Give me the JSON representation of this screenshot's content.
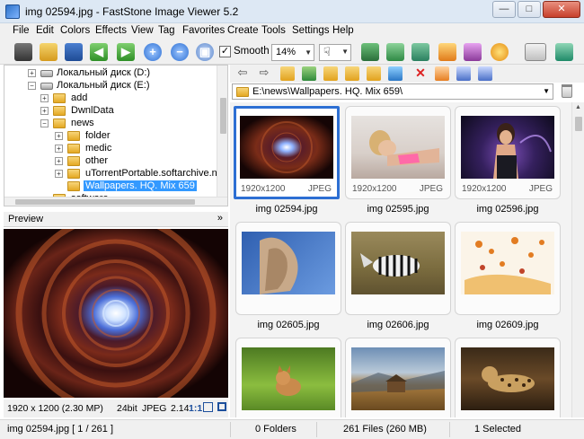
{
  "window": {
    "title": "img 02594.jpg  -  FastStone Image Viewer 5.2",
    "controls": {
      "minimize": "—",
      "maximize": "□",
      "close": "✕"
    }
  },
  "menu": [
    "File",
    "Edit",
    "Colors",
    "Effects",
    "View",
    "Tag",
    "Favorites",
    "Create",
    "Tools",
    "Settings",
    "Help"
  ],
  "toolbar": {
    "smooth_label": "Smooth",
    "smooth_checked": "✓",
    "zoom_value": "14%",
    "hand_tool": "☟"
  },
  "tree": {
    "items": [
      {
        "label": "Локальный диск (D:)"
      },
      {
        "label": "Локальный диск (E:)"
      },
      {
        "label": "add"
      },
      {
        "label": "DwnlData"
      },
      {
        "label": "news"
      },
      {
        "label": "folder"
      },
      {
        "label": "medic"
      },
      {
        "label": "other"
      },
      {
        "label": "uTorrentPortable.softarchive.net"
      },
      {
        "label": "Wallpapers. HQ. Mix 659"
      },
      {
        "label": "software"
      }
    ],
    "expander_plus": "+",
    "expander_minus": "−"
  },
  "preview": {
    "label": "Preview",
    "collapse": "»",
    "info": {
      "dimensions": "1920 x 1200 (2.30 MP)",
      "bitdepth": "24bit",
      "format": "JPEG",
      "ratio": "2.14",
      "actual_size": "1:1"
    }
  },
  "address": {
    "path": "E:\\news\\Wallpapers. HQ. Mix 659\\"
  },
  "thumbnails": [
    {
      "name": "img 02594.jpg",
      "dims": "1920x1200",
      "format": "JPEG",
      "selected": true
    },
    {
      "name": "img 02595.jpg",
      "dims": "1920x1200",
      "format": "JPEG",
      "selected": false
    },
    {
      "name": "img 02596.jpg",
      "dims": "1920x1200",
      "format": "JPEG",
      "selected": false
    },
    {
      "name": "img 02605.jpg",
      "dims": "",
      "format": "",
      "selected": false
    },
    {
      "name": "img 02606.jpg",
      "dims": "",
      "format": "",
      "selected": false
    },
    {
      "name": "img 02609.jpg",
      "dims": "",
      "format": "",
      "selected": false
    },
    {
      "name": "",
      "dims": "",
      "format": "",
      "selected": false
    },
    {
      "name": "",
      "dims": "",
      "format": "",
      "selected": false
    },
    {
      "name": "",
      "dims": "",
      "format": "",
      "selected": false
    }
  ],
  "status": {
    "file": "img 02594.jpg [ 1 / 261 ]",
    "folders": "0 Folders",
    "files": "261 Files (260 MB)",
    "selected": "1 Selected"
  },
  "colors": {
    "selection": "#3399ff",
    "thumb_selected_border": "#2d6fd3"
  }
}
